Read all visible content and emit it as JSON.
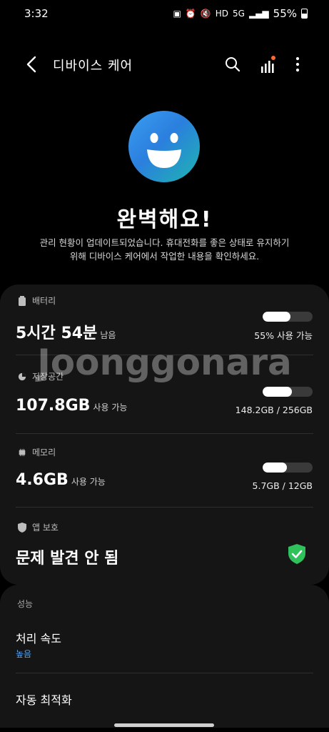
{
  "status": {
    "time": "3:32",
    "battery_percent": "55%",
    "network": "5G",
    "hd": "HD"
  },
  "header": {
    "title": "디바이스 케어"
  },
  "hero": {
    "headline": "완벽해요!",
    "description_line1": "관리 현황이 업데이트되었습니다. 휴대전화를 좋은 상태로 유지하기",
    "description_line2": "위해 디바이스 케어에서 작업한 내용을 확인하세요."
  },
  "battery": {
    "label": "배터리",
    "value": "5시간 54분",
    "unit": "남음",
    "usage_note": "55% 사용 가능",
    "fill": 0.55
  },
  "storage": {
    "label": "저장공간",
    "value": "107.8GB",
    "unit": "사용 가능",
    "usage_note": "148.2GB / 256GB",
    "fill": 0.58
  },
  "memory": {
    "label": "메모리",
    "value": "4.6GB",
    "unit": "사용 가능",
    "usage_note": "5.7GB / 12GB",
    "fill": 0.48
  },
  "watermark": "Joonggonara",
  "app_protection": {
    "label": "앱 보호",
    "value": "문제 발견 안 됨"
  },
  "performance": {
    "section_label": "성능",
    "items": [
      {
        "title": "처리 속도",
        "subtitle": "높음"
      },
      {
        "title": "자동 최적화",
        "subtitle": ""
      }
    ]
  },
  "colors": {
    "accent_blue": "#4fa8ff",
    "shield_green": "#2fc25b",
    "badge_orange": "#ff6a2b",
    "card_bg": "#151515"
  }
}
